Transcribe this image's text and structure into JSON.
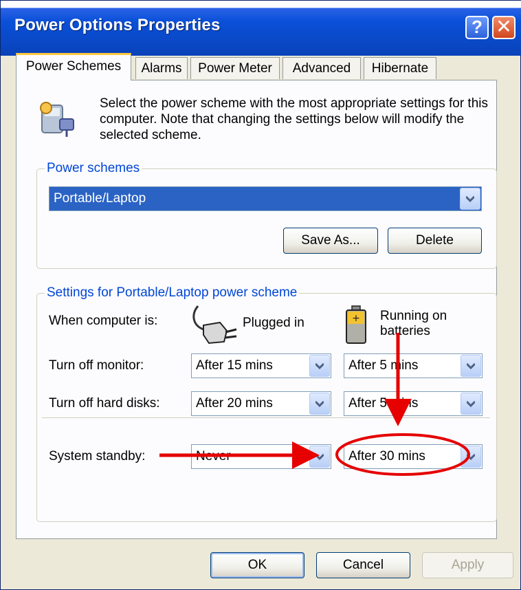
{
  "window": {
    "title": "Power Options Properties"
  },
  "tabs": [
    {
      "label": "Power Schemes",
      "active": true
    },
    {
      "label": "Alarms",
      "active": false
    },
    {
      "label": "Power Meter",
      "active": false
    },
    {
      "label": "Advanced",
      "active": false
    },
    {
      "label": "Hibernate",
      "active": false
    }
  ],
  "intro": {
    "text": "Select the power scheme with the most appropriate settings for this computer. Note that changing the settings below will modify the selected scheme."
  },
  "power_schemes": {
    "legend": "Power schemes",
    "selected": "Portable/Laptop",
    "save_as_label": "Save As...",
    "delete_label": "Delete"
  },
  "settings": {
    "legend": "Settings for Portable/Laptop power scheme",
    "when_label": "When computer is:",
    "plugged_label": "Plugged in",
    "battery_label": "Running on batteries",
    "rows": [
      {
        "label": "Turn off monitor:",
        "plugged": "After 15 mins",
        "battery": "After 5 mins"
      },
      {
        "label": "Turn off hard disks:",
        "plugged": "After 20 mins",
        "battery": "After 5 mins"
      },
      {
        "label": "System standby:",
        "plugged": "Never",
        "battery": "After 30 mins"
      }
    ]
  },
  "footer": {
    "ok_label": "OK",
    "cancel_label": "Cancel",
    "apply_label": "Apply"
  },
  "colors": {
    "title_bar": "#0A50D8",
    "legend_text": "#0046D5",
    "annotation": "#E60000",
    "dialog_bg": "#ECE9D8"
  },
  "icons": [
    "help-icon",
    "close-icon",
    "power-scheme-icon",
    "plug-icon",
    "battery-icon",
    "dropdown-arrow-icon"
  ]
}
